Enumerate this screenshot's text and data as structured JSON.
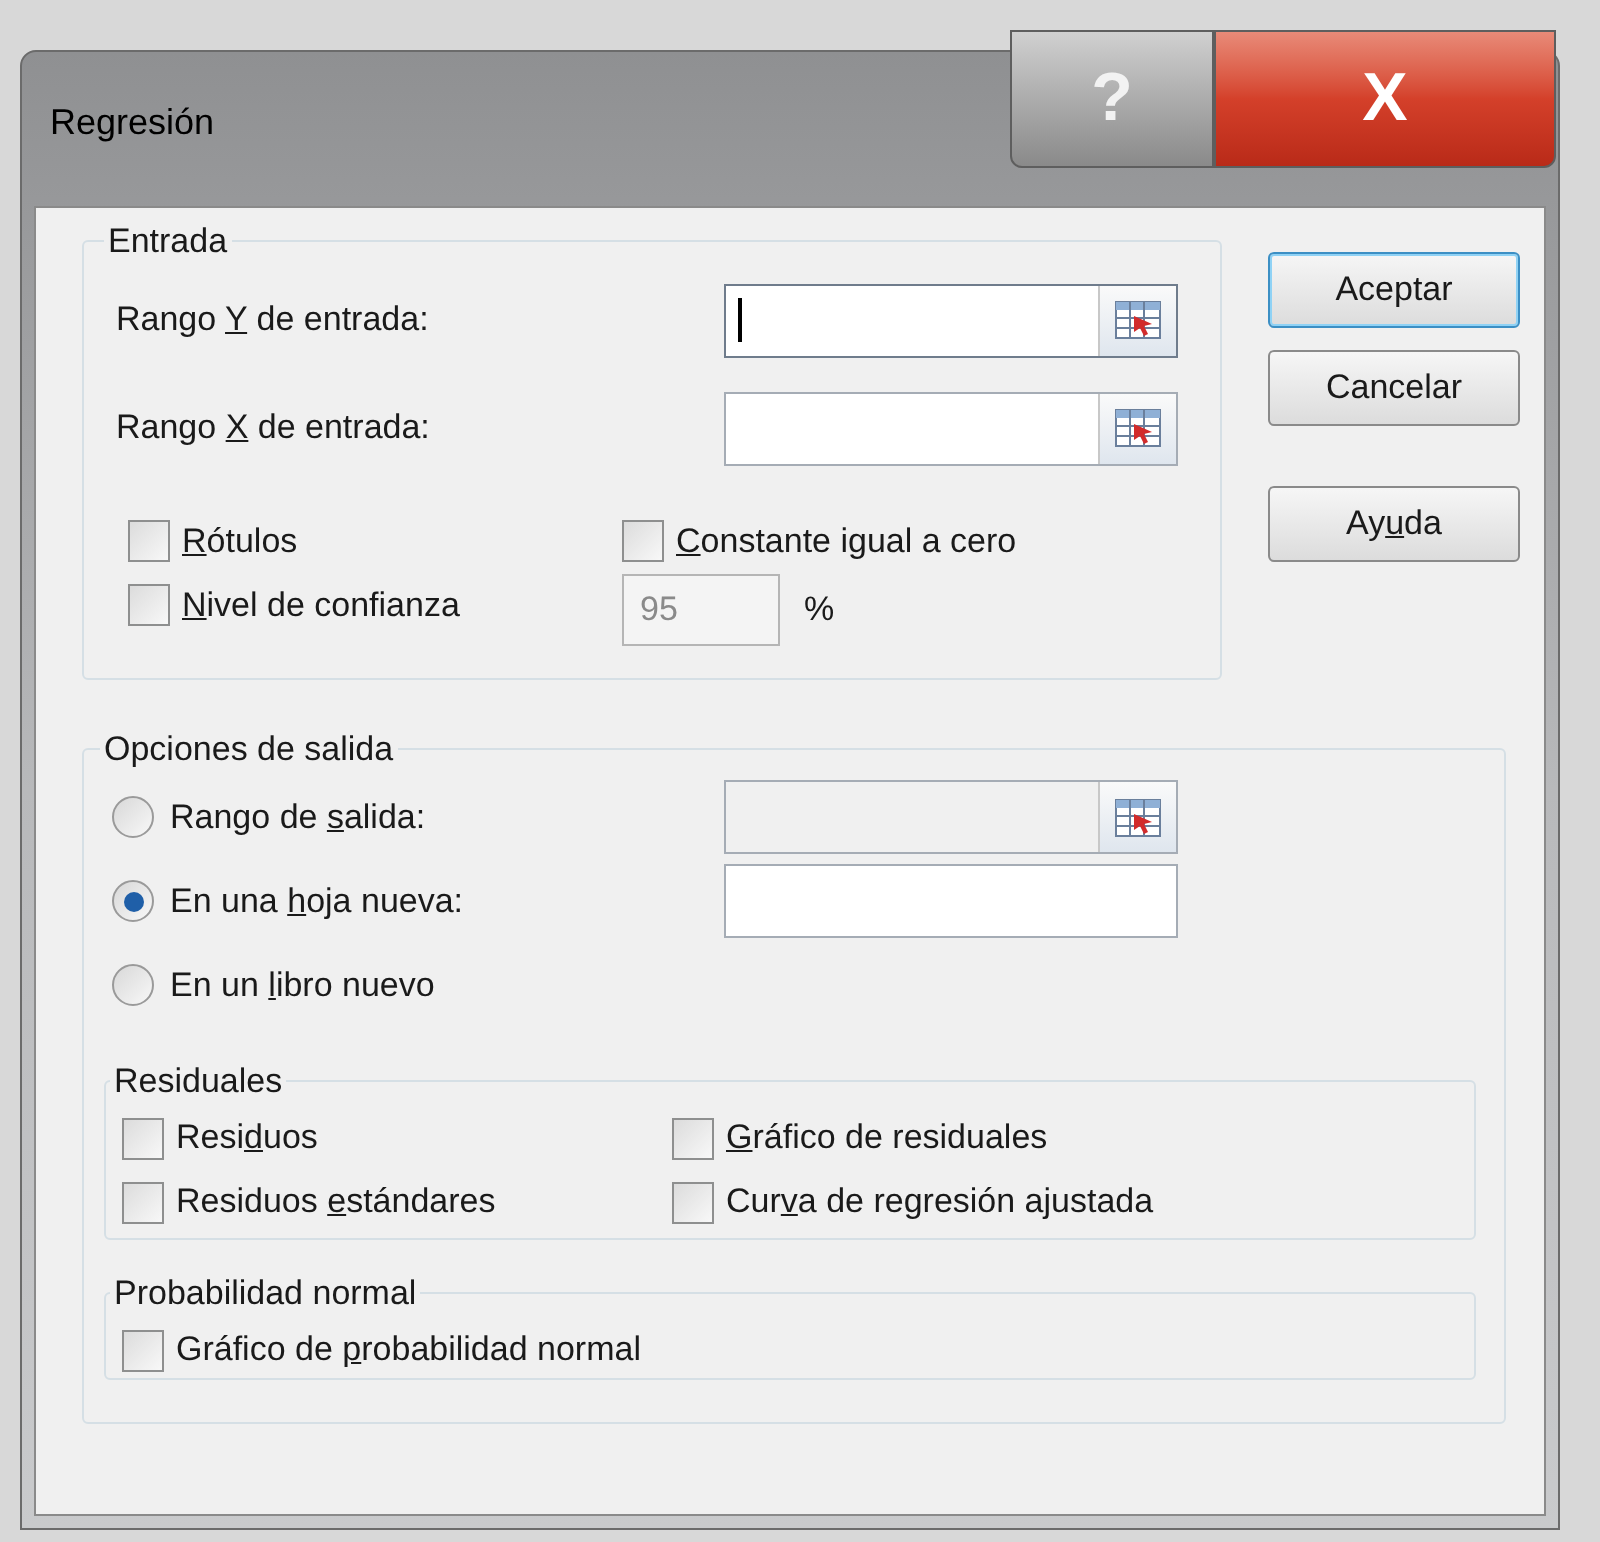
{
  "window": {
    "title": "Regresión"
  },
  "title_buttons": [
    {
      "kind": "help",
      "text": "?"
    },
    {
      "kind": "close",
      "text": "X"
    }
  ],
  "input_group": {
    "title": "Entrada",
    "fields": [
      {
        "label": {
          "pre": "Rango ",
          "key": "Y",
          "post": " de entrada:"
        },
        "focused": true
      },
      {
        "label": {
          "pre": "Rango ",
          "key": "X",
          "post": " de entrada:"
        },
        "focused": false
      }
    ],
    "checkboxes": [
      {
        "label": {
          "key": "R",
          "post": "ótulos"
        },
        "checked": false
      },
      {
        "label": {
          "key": "C",
          "post": "onstante igual a cero"
        },
        "checked": false
      },
      {
        "label": {
          "key": "N",
          "post": "ivel de confianza"
        },
        "checked": false
      }
    ],
    "confidence": {
      "value": "95",
      "disabled": true,
      "unit": "%"
    }
  },
  "buttons": [
    {
      "label": {
        "pre": "Aceptar"
      },
      "default": true
    },
    {
      "label": {
        "pre": "Cancelar"
      },
      "default": false
    },
    {
      "label": {
        "pre": "Ay",
        "key": "u",
        "post": "da"
      },
      "default": false
    }
  ],
  "output_group": {
    "title": "Opciones de salida",
    "radios": [
      {
        "label": {
          "pre": "Rango de ",
          "key": "s",
          "post": "alida:"
        },
        "selected": false,
        "field": {
          "disabled": true,
          "picker": true
        }
      },
      {
        "label": {
          "pre": "En una ",
          "key": "h",
          "post": "oja nueva:"
        },
        "selected": true,
        "field": {
          "disabled": false,
          "picker": false
        }
      },
      {
        "label": {
          "pre": "En un ",
          "key": "l",
          "post": "ibro nuevo"
        },
        "selected": false
      }
    ],
    "residuals": {
      "title": "Residuales",
      "checkboxes": [
        {
          "label": {
            "pre": "Resi",
            "key": "d",
            "post": "uos"
          },
          "checked": false
        },
        {
          "label": {
            "key": "G",
            "post": "ráfico de residuales"
          },
          "checked": false
        },
        {
          "label": {
            "pre": "Residuos ",
            "key": "e",
            "post": "stándares"
          },
          "checked": false
        },
        {
          "label": {
            "pre": "Cur",
            "key": "v",
            "post": "a de regresión ajustada"
          },
          "checked": false
        }
      ]
    },
    "normal_probability": {
      "title": "Probabilidad normal",
      "checkboxes": [
        {
          "label": {
            "pre": "Gráfico de ",
            "key": "p",
            "post": "robabilidad normal"
          },
          "checked": false
        }
      ]
    }
  }
}
